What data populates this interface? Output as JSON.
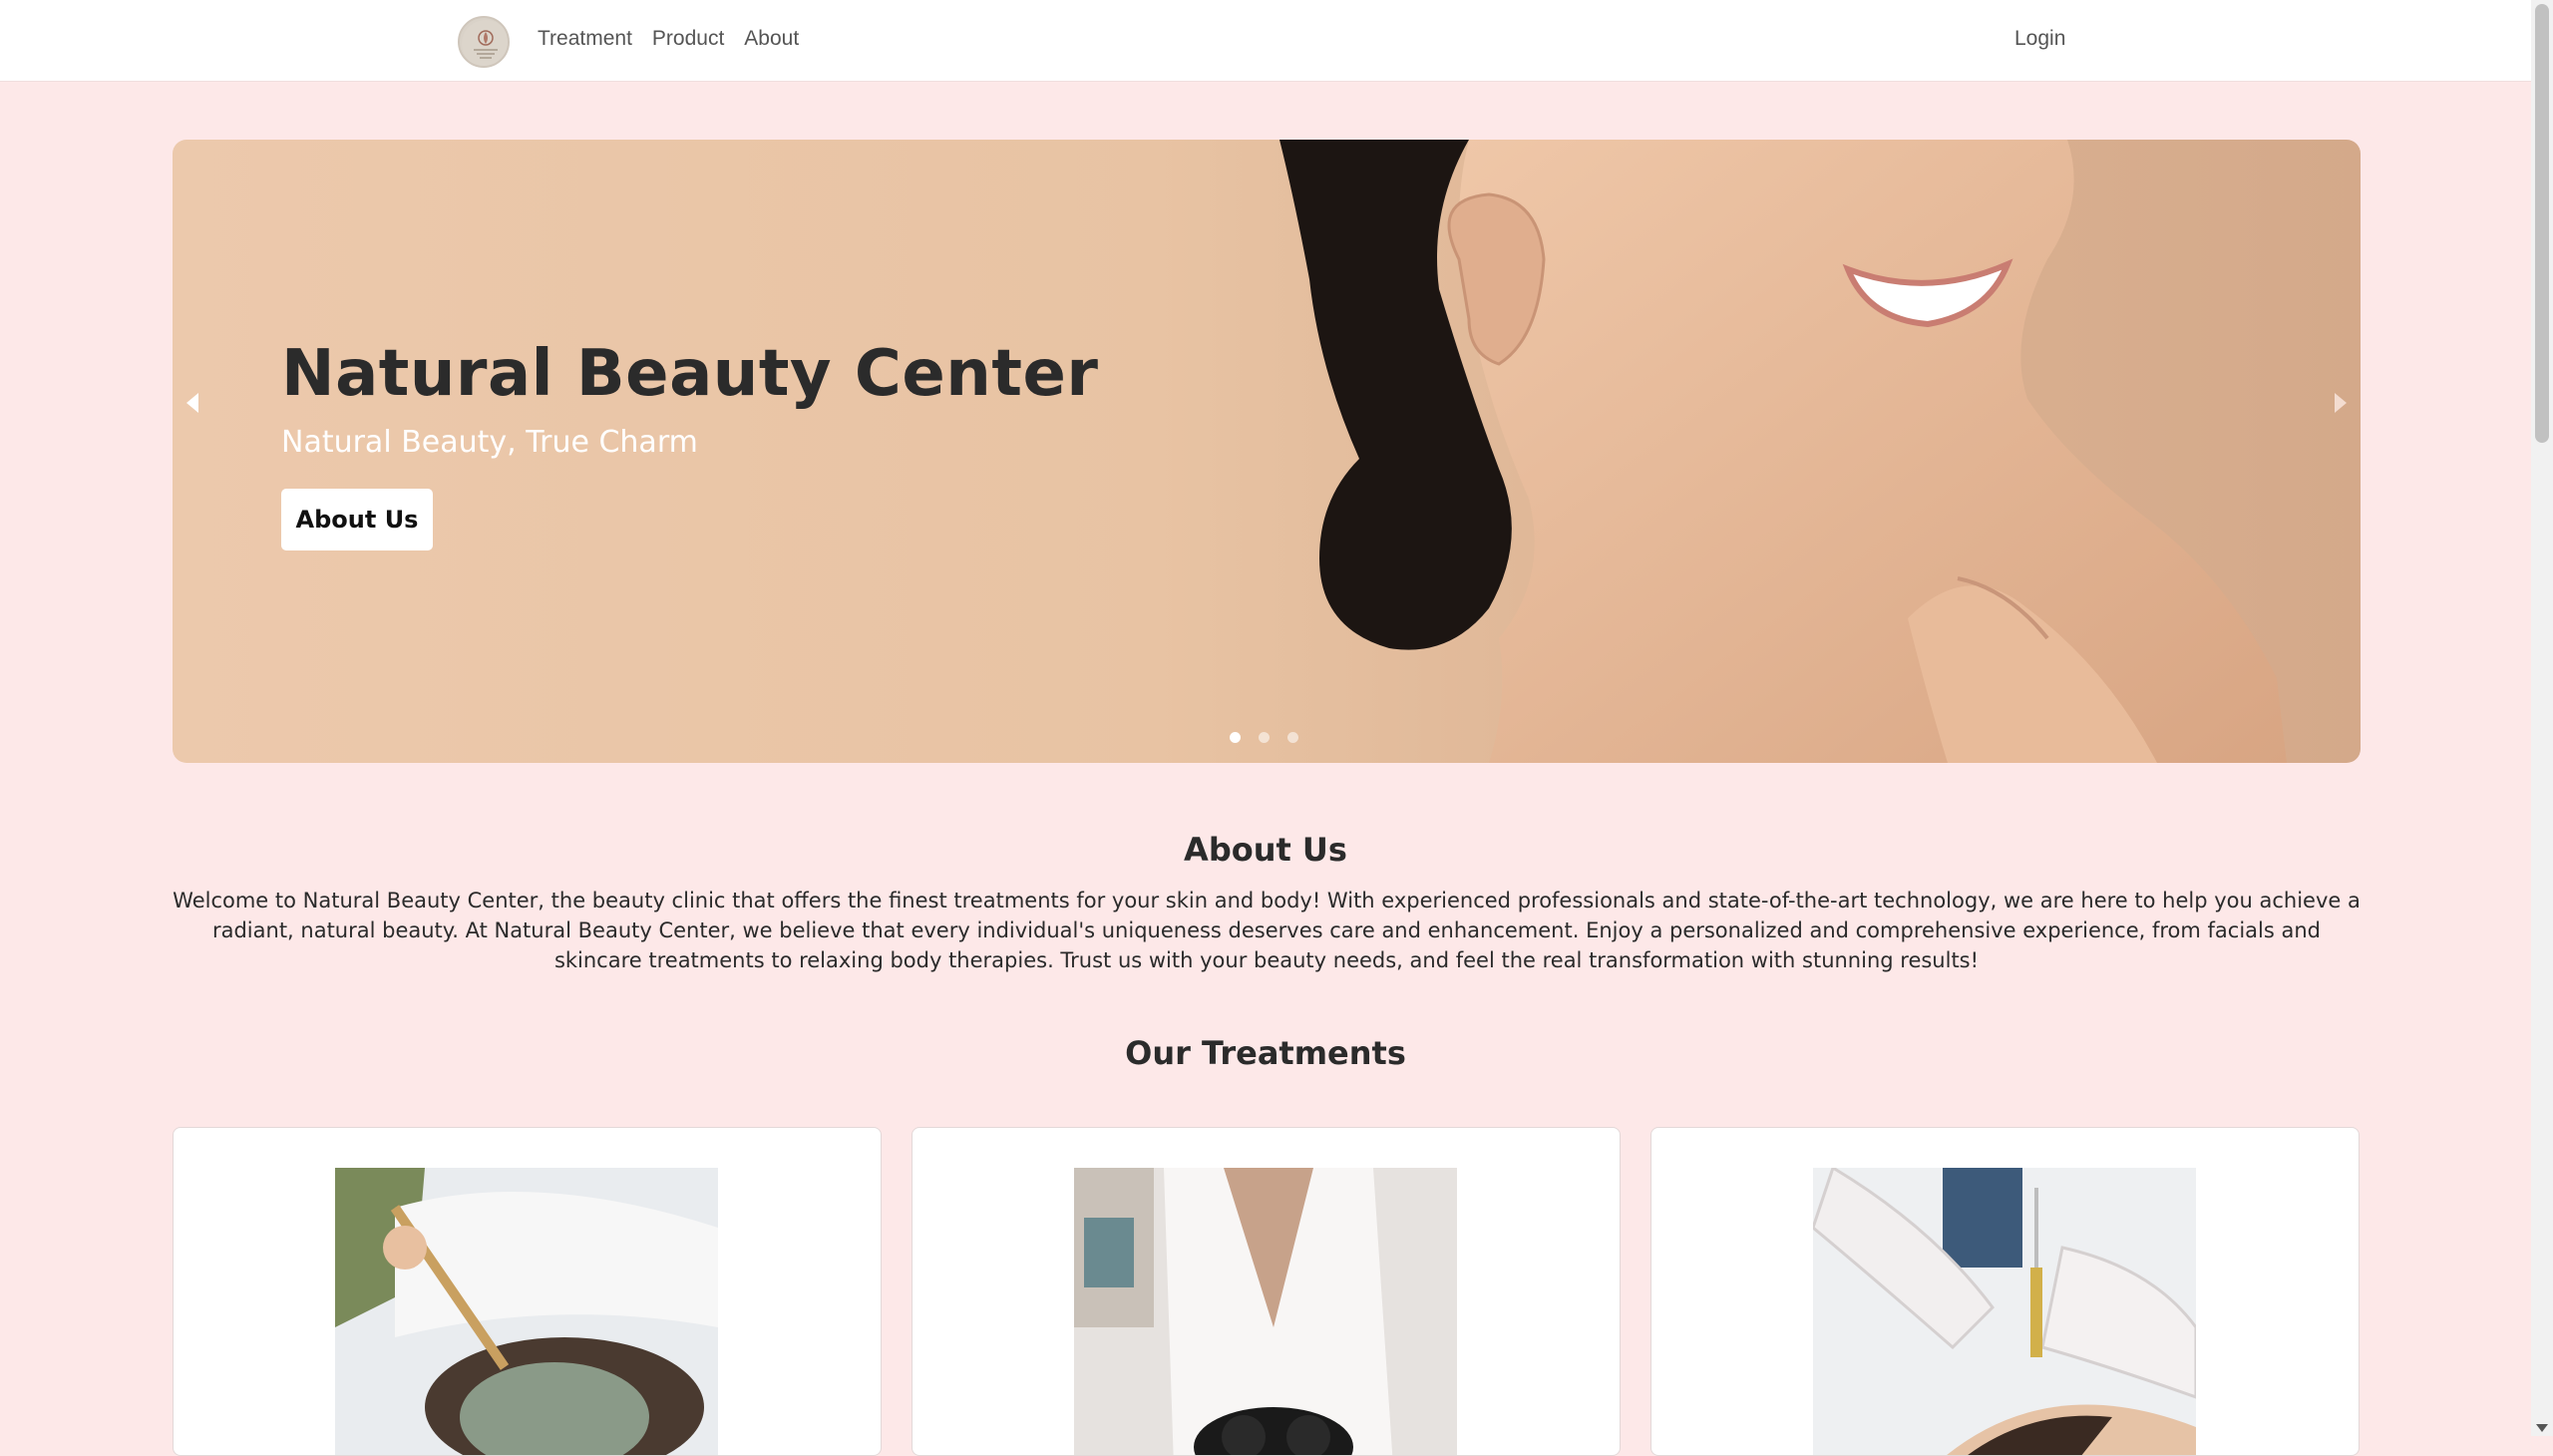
{
  "nav": {
    "logo_icon": "natural-beauty-center-logo",
    "links": [
      "Treatment",
      "Product",
      "About"
    ],
    "login": "Login"
  },
  "hero": {
    "title": "Natural Beauty Center",
    "subtitle": "Natural Beauty, True Charm",
    "button": "About Us",
    "slide_count": 3,
    "active_slide": 1,
    "prev_icon": "chevron-left-icon",
    "next_icon": "chevron-right-icon"
  },
  "about": {
    "title": "About Us",
    "text": "Welcome to Natural Beauty Center, the beauty clinic that offers the finest treatments for your skin and body! With experienced professionals and state-of-the-art technology, we are here to help you achieve a radiant, natural beauty. At Natural Beauty Center, we believe that every individual's uniqueness deserves care and enhancement. Enjoy a personalized and comprehensive experience, from facials and skincare treatments to relaxing body therapies. Trust us with your beauty needs, and feel the real transformation with stunning results!"
  },
  "treatments": {
    "title": "Our Treatments",
    "cards": [
      {
        "image": "facial-mask-treatment-photo"
      },
      {
        "image": "laser-treatment-photo"
      },
      {
        "image": "injection-treatment-photo"
      }
    ]
  },
  "colors": {
    "page_bg": "#fde8e8",
    "hero_bg": "#e8c3a3",
    "text": "#2b2b2b"
  }
}
